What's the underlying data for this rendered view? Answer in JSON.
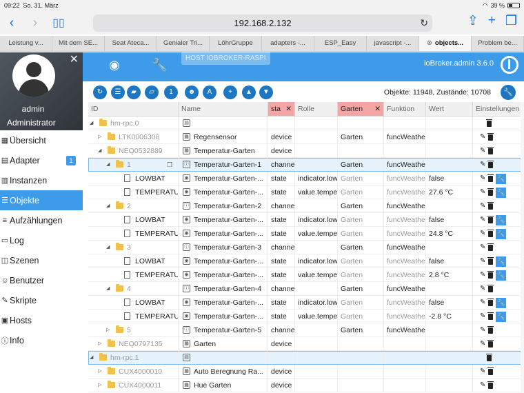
{
  "status": {
    "time": "09:22",
    "date": "So. 31. März",
    "battery": "39 %",
    "battery_level": 0.39
  },
  "browser": {
    "url": "192.168.2.132"
  },
  "tabs": [
    {
      "label": "Leistung v...",
      "active": false
    },
    {
      "label": "Mit dem SE...",
      "active": false
    },
    {
      "label": "Seat Ateca...",
      "active": false
    },
    {
      "label": "Genialer Tri...",
      "active": false
    },
    {
      "label": "LöhrGruppe",
      "active": false
    },
    {
      "label": "adapters -...",
      "active": false
    },
    {
      "label": "ESP_Easy",
      "active": false
    },
    {
      "label": "javascript -...",
      "active": false
    },
    {
      "label": "objects...",
      "active": true
    },
    {
      "label": "Problem be...",
      "active": false
    }
  ],
  "profile": {
    "name": "admin",
    "role": "Administrator"
  },
  "menu": [
    {
      "label": "Übersicht",
      "icon": "dashboard-icon",
      "glyph": "▦"
    },
    {
      "label": "Adapter",
      "icon": "adapter-icon",
      "glyph": "▤",
      "badge": "1"
    },
    {
      "label": "Instanzen",
      "icon": "instances-icon",
      "glyph": "▥"
    },
    {
      "label": "Objekte",
      "icon": "objects-icon",
      "glyph": "☰",
      "active": true
    },
    {
      "label": "Aufzählungen",
      "icon": "enums-icon",
      "glyph": "≡"
    },
    {
      "label": "Log",
      "icon": "log-icon",
      "glyph": "▭"
    },
    {
      "label": "Szenen",
      "icon": "scenes-icon",
      "glyph": "◫"
    },
    {
      "label": "Benutzer",
      "icon": "users-icon",
      "glyph": "☺"
    },
    {
      "label": "Skripte",
      "icon": "scripts-icon",
      "glyph": "✎"
    },
    {
      "label": "Hosts",
      "icon": "hosts-icon",
      "glyph": "▣"
    },
    {
      "label": "Info",
      "icon": "info-icon",
      "glyph": "ⓘ"
    }
  ],
  "topbar": {
    "host": "HOST IOBROKER-RASPI",
    "brand": "ioBroker.admin 3.6.0"
  },
  "toolbar": {
    "buttons": [
      {
        "name": "refresh-button",
        "glyph": "↻"
      },
      {
        "name": "list-view-button",
        "glyph": "☰"
      },
      {
        "name": "folder-collapse-button",
        "glyph": "▰"
      },
      {
        "name": "folder-expand-button",
        "glyph": "▱"
      },
      {
        "name": "level-button",
        "glyph": "1"
      },
      {
        "name": "user-button",
        "glyph": "☻"
      },
      {
        "name": "sort-az-button",
        "glyph": "A"
      },
      {
        "name": "add-button",
        "glyph": "+"
      },
      {
        "name": "upload-button",
        "glyph": "▲"
      },
      {
        "name": "download-button",
        "glyph": "▼"
      }
    ],
    "stats": "Objekte: 11948, Zustände: 10708"
  },
  "columns": [
    {
      "label": "ID",
      "filter": false
    },
    {
      "label": "Name",
      "filter": false
    },
    {
      "label": "sta",
      "filter": true
    },
    {
      "label": "Rolle",
      "filter": false
    },
    {
      "label": "Garten",
      "filter": true
    },
    {
      "label": "Funktion",
      "filter": false
    },
    {
      "label": "Wert",
      "filter": false
    },
    {
      "label": "Einstellungen",
      "filter": false
    }
  ],
  "rows": [
    {
      "level": 0,
      "tog": "◢",
      "kind": "folder",
      "id": "hm-rpc.0",
      "nicon": "doc",
      "name": "",
      "type": "",
      "role": "",
      "room": "",
      "func": "",
      "val": "",
      "edit": false,
      "wr": false
    },
    {
      "level": 1,
      "tog": "▷",
      "kind": "folder",
      "id": "LTK0006308",
      "nicon": "dev",
      "name": "Regensensor",
      "type": "device",
      "role": "",
      "room": "Garten",
      "func": "funcWeather",
      "val": "",
      "edit": true,
      "wr": false
    },
    {
      "level": 1,
      "tog": "◢",
      "kind": "folder",
      "id": "NEQ0532889",
      "nicon": "dev",
      "name": "Temperatur-Garten",
      "type": "device",
      "role": "",
      "room": "",
      "func": "",
      "val": "",
      "edit": true,
      "wr": false
    },
    {
      "level": 2,
      "tog": "◢",
      "kind": "folder",
      "id": "1",
      "nicon": "ch",
      "name": "Temperatur-Garten-1",
      "type": "channel",
      "role": "",
      "room": "Garten",
      "func": "funcWeather",
      "val": "",
      "edit": true,
      "wr": false,
      "selected": true,
      "copy": true
    },
    {
      "level": 3,
      "tog": "",
      "kind": "file",
      "id": "LOWBAT",
      "nicon": "st",
      "name": "Temperatur-Garten-...",
      "type": "state",
      "role": "indicator.lowbat",
      "room": "Garten",
      "func": "funcWeather",
      "val": "false",
      "edit": true,
      "wr": true,
      "grey": true
    },
    {
      "level": 3,
      "tog": "",
      "kind": "file",
      "id": "TEMPERATURE",
      "nicon": "st",
      "name": "Temperatur-Garten-...",
      "type": "state",
      "role": "value.temperature",
      "room": "Garten",
      "func": "funcWeather",
      "val": "27.6 °C",
      "edit": true,
      "wr": true,
      "grey": true
    },
    {
      "level": 2,
      "tog": "◢",
      "kind": "folder",
      "id": "2",
      "nicon": "ch",
      "name": "Temperatur-Garten-2",
      "type": "channel",
      "role": "",
      "room": "Garten",
      "func": "funcWeather",
      "val": "",
      "edit": true,
      "wr": false
    },
    {
      "level": 3,
      "tog": "",
      "kind": "file",
      "id": "LOWBAT",
      "nicon": "st",
      "name": "Temperatur-Garten-...",
      "type": "state",
      "role": "indicator.lowbat",
      "room": "Garten",
      "func": "funcWeather",
      "val": "false",
      "edit": true,
      "wr": true,
      "grey": true
    },
    {
      "level": 3,
      "tog": "",
      "kind": "file",
      "id": "TEMPERATURE",
      "nicon": "st",
      "name": "Temperatur-Garten-...",
      "type": "state",
      "role": "value.temperature",
      "room": "Garten",
      "func": "funcWeather",
      "val": "24.8 °C",
      "edit": true,
      "wr": true,
      "grey": true
    },
    {
      "level": 2,
      "tog": "◢",
      "kind": "folder",
      "id": "3",
      "nicon": "ch",
      "name": "Temperatur-Garten-3",
      "type": "channel",
      "role": "",
      "room": "Garten",
      "func": "funcWeather",
      "val": "",
      "edit": true,
      "wr": false
    },
    {
      "level": 3,
      "tog": "",
      "kind": "file",
      "id": "LOWBAT",
      "nicon": "st",
      "name": "Temperatur-Garten-...",
      "type": "state",
      "role": "indicator.lowbat",
      "room": "Garten",
      "func": "funcWeather",
      "val": "false",
      "edit": true,
      "wr": true,
      "grey": true
    },
    {
      "level": 3,
      "tog": "",
      "kind": "file",
      "id": "TEMPERATURE",
      "nicon": "st",
      "name": "Temperatur-Garten-...",
      "type": "state",
      "role": "value.temperature",
      "room": "Garten",
      "func": "funcWeather",
      "val": "2.8 °C",
      "edit": true,
      "wr": true,
      "grey": true
    },
    {
      "level": 2,
      "tog": "◢",
      "kind": "folder",
      "id": "4",
      "nicon": "ch",
      "name": "Temperatur-Garten-4",
      "type": "channel",
      "role": "",
      "room": "Garten",
      "func": "funcWeather",
      "val": "",
      "edit": true,
      "wr": false
    },
    {
      "level": 3,
      "tog": "",
      "kind": "file",
      "id": "LOWBAT",
      "nicon": "st",
      "name": "Temperatur-Garten-...",
      "type": "state",
      "role": "indicator.lowbat",
      "room": "Garten",
      "func": "funcWeather",
      "val": "false",
      "edit": true,
      "wr": true,
      "grey": true
    },
    {
      "level": 3,
      "tog": "",
      "kind": "file",
      "id": "TEMPERATURE",
      "nicon": "st",
      "name": "Temperatur-Garten-...",
      "type": "state",
      "role": "value.temperature",
      "room": "Garten",
      "func": "funcWeather",
      "val": "-2.8 °C",
      "edit": true,
      "wr": true,
      "grey": true
    },
    {
      "level": 2,
      "tog": "▷",
      "kind": "folder",
      "id": "5",
      "nicon": "ch",
      "name": "Temperatur-Garten-5",
      "type": "channel",
      "role": "",
      "room": "Garten",
      "func": "funcWeather",
      "val": "",
      "edit": true,
      "wr": false
    },
    {
      "level": 1,
      "tog": "▷",
      "kind": "folder",
      "id": "NEQ0797135",
      "nicon": "dev",
      "name": "Garten",
      "type": "device",
      "role": "",
      "room": "",
      "func": "",
      "val": "",
      "edit": true,
      "wr": false
    },
    {
      "level": 0,
      "tog": "◢",
      "kind": "folder",
      "id": "hm-rpc.1",
      "nicon": "doc",
      "name": "",
      "type": "",
      "role": "",
      "room": "",
      "func": "",
      "val": "",
      "edit": false,
      "wr": false,
      "selected": true
    },
    {
      "level": 1,
      "tog": "▷",
      "kind": "folder",
      "id": "CUX4000010",
      "nicon": "dev",
      "name": "Auto Beregnung Ra...",
      "type": "device",
      "role": "",
      "room": "",
      "func": "",
      "val": "",
      "edit": true,
      "wr": false
    },
    {
      "level": 1,
      "tog": "▷",
      "kind": "folder",
      "id": "CUX4000011",
      "nicon": "dev",
      "name": "Hue Garten",
      "type": "device",
      "role": "",
      "room": "",
      "func": "",
      "val": "",
      "edit": true,
      "wr": false
    }
  ]
}
